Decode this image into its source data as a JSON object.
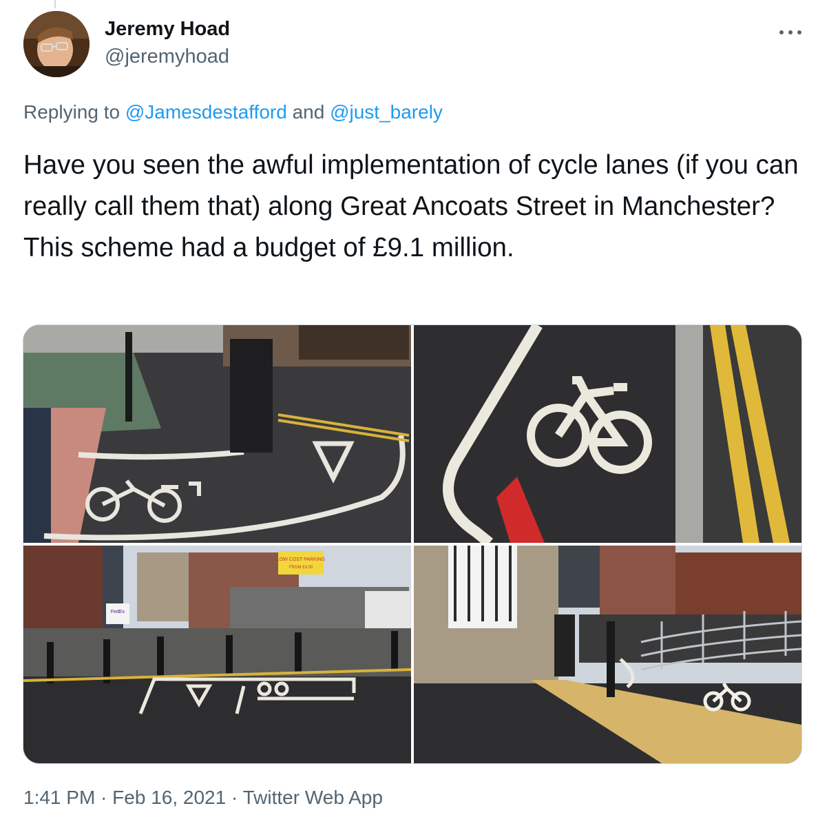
{
  "author": {
    "name": "Jeremy Hoad",
    "handle": "@jeremyhoad"
  },
  "reply": {
    "prefix": "Replying to ",
    "user1": "@Jamesdestafford",
    "joiner": " and ",
    "user2": "@just_barely"
  },
  "tweet": {
    "text": "Have you seen the awful implementation of cycle lanes (if you can really call them that) along Great Ancoats Street in Manchester? This scheme had a budget of £9.1 million."
  },
  "photos": {
    "sign_line1": "LOW COST PARKING",
    "sign_line2": "FROM £3.00",
    "van_text": "FedEx"
  },
  "meta": {
    "time": "1:41 PM",
    "dot": " · ",
    "date": "Feb 16, 2021",
    "app": "Twitter Web App"
  },
  "colors": {
    "link": "#1d9bf0",
    "secondary_text": "#536471"
  },
  "icons": {
    "more": "more-horizontal-icon"
  }
}
